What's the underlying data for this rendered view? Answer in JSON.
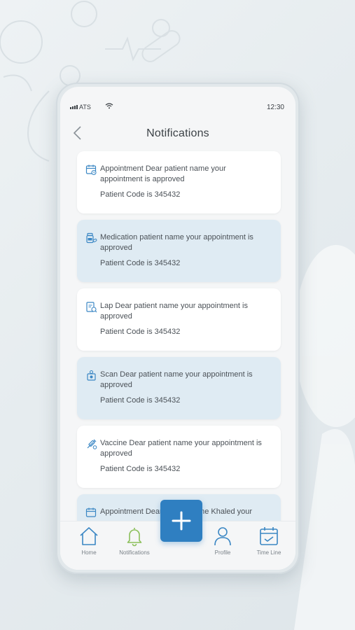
{
  "status_bar": {
    "carrier": "ATS",
    "time": "12:30"
  },
  "header": {
    "title": "Notifications"
  },
  "notifications": [
    {
      "icon": "calendar-icon",
      "message": "Appointment Dear patient name your appointment is approved",
      "code": "Patient Code is 345432",
      "highlighted": false
    },
    {
      "icon": "medication-icon",
      "message": "Medication patient name your appointment is approved",
      "code": "Patient Code is 345432",
      "highlighted": true
    },
    {
      "icon": "lab-report-icon",
      "message": "Lap Dear patient name your appointment is approved",
      "code": "Patient Code is 345432",
      "highlighted": false
    },
    {
      "icon": "scan-icon",
      "message": "Scan Dear patient name your appointment is approved",
      "code": "Patient Code is 345432",
      "highlighted": true
    },
    {
      "icon": "vaccine-icon",
      "message": "Vaccine Dear patient name your appointment is approved",
      "code": "Patient Code is 345432",
      "highlighted": false
    },
    {
      "icon": "calendar-icon",
      "message": "Appointment Dear patient name Khaled your",
      "code": "",
      "highlighted": true
    }
  ],
  "bottom_nav": {
    "items": [
      {
        "label": "Home",
        "icon": "home-icon"
      },
      {
        "label": "Notifications",
        "icon": "bell-icon"
      },
      {
        "label": "Profile",
        "icon": "profile-icon"
      },
      {
        "label": "Time Line",
        "icon": "calendar-check-icon"
      }
    ],
    "fab_icon": "plus-icon"
  },
  "colors": {
    "accent": "#2f7fc1",
    "highlight_card": "#dfebf3",
    "active_nav": "#8bbf5a",
    "icon_blue": "#3b87c4"
  }
}
